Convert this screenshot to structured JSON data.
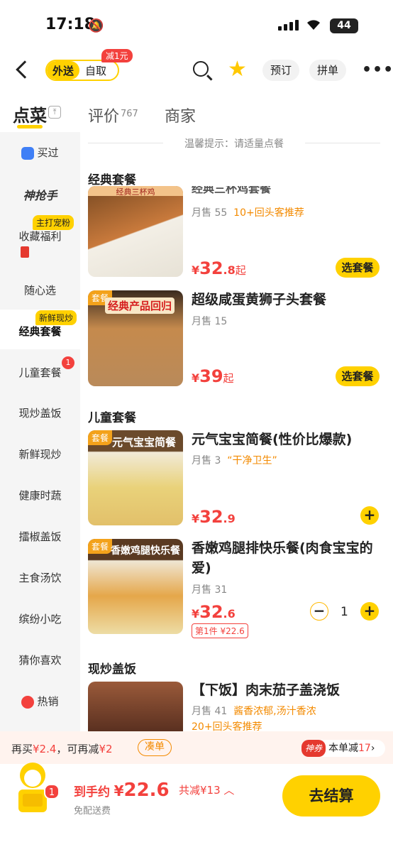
{
  "status_bar": {
    "time": "17:18",
    "battery": "44"
  },
  "nav": {
    "delivery": "外送",
    "pickup": "自取",
    "discount_badge": "减1元",
    "reserve": "预订",
    "group": "拼单"
  },
  "tabs": {
    "dishes": "点菜",
    "reviews": "评价",
    "reviews_count": "767",
    "merchant": "商家"
  },
  "sidebar": {
    "bought": "买过",
    "shen_logo": "神抢手",
    "fav_tag": "主打宠粉",
    "fav": "收藏福利",
    "random": "随心选",
    "fresh_tag": "新鲜现炒",
    "classic": "经典套餐",
    "kids": "儿童套餐",
    "kids_badge": "1",
    "stir": "现炒盖饭",
    "fresh": "新鲜现炒",
    "veg": "健康时蔬",
    "chili": "擂椒盖饭",
    "staple": "主食汤饮",
    "snack": "缤纷小吃",
    "guess": "猜你喜欢",
    "hot": "热销"
  },
  "tip": "温馨提示：请适量点餐",
  "sections": {
    "classic": "经典套餐",
    "kids": "儿童套餐",
    "stir": "现炒盖饭"
  },
  "items": [
    {
      "name": "经典三杯鸡套餐",
      "sales": "月售 55",
      "tag": "10+回头客推荐",
      "price_int": "32",
      "price_dec": ".8",
      "suffix": "起",
      "btn": "选套餐",
      "img_text": "经典三杯鸡"
    },
    {
      "name": "超级咸蛋黄狮子头套餐",
      "sales": "月售 15",
      "price_int": "39",
      "suffix": "起",
      "btn": "选套餐",
      "set": "套餐",
      "img_text": "经典产品回归"
    },
    {
      "name": "元气宝宝简餐(性价比爆款)",
      "sales": "月售 3",
      "tag": "“干净卫生”",
      "price_int": "32",
      "price_dec": ".9",
      "set": "套餐",
      "img_text": "元气宝宝简餐"
    },
    {
      "name": "香嫩鸡腿排快乐餐(肉食宝宝的爱)",
      "sales": "月售 31",
      "price_int": "32",
      "price_dec": ".6",
      "first_deal": "第1件 ¥22.6",
      "qty": "1",
      "set": "套餐",
      "img_text": "香嫩鸡腿快乐餐"
    },
    {
      "name": "【下饭】肉末茄子盖浇饭",
      "sales": "月售 41",
      "tag": "酱香浓郁,汤汁香浓",
      "tag2": "20+回头客推荐"
    }
  ],
  "promo": {
    "text1": "再买",
    "amt1": "¥2.4",
    "text2": "，可再减",
    "amt2": "¥2",
    "couban": "凑单",
    "shen": "神券",
    "cut": "本单减",
    "cut_amt": "17"
  },
  "bottom": {
    "cart_count": "1",
    "label": "到手约",
    "yen": "¥",
    "total": "22.6",
    "saved": "共减¥13",
    "delivery": "免配送费",
    "checkout": "去结算"
  },
  "colors": {
    "accent": "#ffd100",
    "price": "#f3413d",
    "highlight": "#f38a00"
  }
}
